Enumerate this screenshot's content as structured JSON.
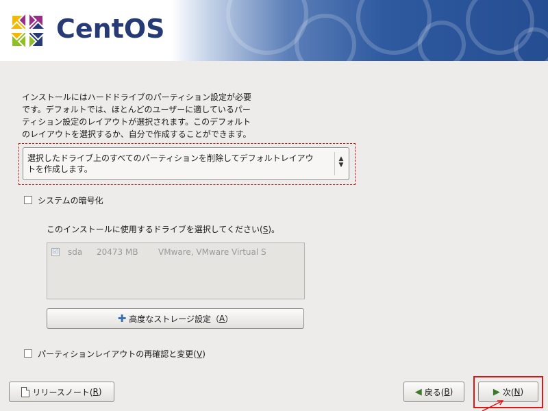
{
  "header": {
    "logo_text": "CentOS",
    "logo_icon": "centos-logo-icon",
    "colors": {
      "banner": "#2f5aa0",
      "logo_text": "#263a75"
    }
  },
  "intro": {
    "lines": [
      "インストールにはハードドライブのパーティション設定が必要",
      "です。デフォルトでは、ほとんどのユーザーに適しているパー",
      "ティション設定のレイアウトが選択されます。このデフォルト",
      "のレイアウトを選択するか、自分で作成することができます。"
    ]
  },
  "layout_combo": {
    "lines": [
      "選択したドライブ上のすべてのパーティションを削除してデフォルトレイアウ",
      "トを作成します。"
    ],
    "arrow_up": "▲",
    "arrow_down": "▼"
  },
  "encrypt": {
    "label": "システムの暗号化",
    "checked": false
  },
  "drives": {
    "label_pre": "このインストールに使用するドライブを選択してください(",
    "label_key": "S",
    "label_post": ")。",
    "items": [
      {
        "checked": true,
        "check_mark": "☑",
        "name": "sda",
        "size": "20473 MB",
        "model": "VMware, VMware Virtual S"
      }
    ]
  },
  "advanced_button": {
    "label_pre": "高度なストレージ設定（",
    "key": "A",
    "label_post": "）",
    "icon": "plus-icon"
  },
  "review": {
    "label_pre": "パーティションレイアウトの再確認と変更(",
    "key": "V",
    "label_post": ")",
    "checked": false
  },
  "footer": {
    "release_notes": {
      "label_pre": "リリースノート(",
      "key": "R",
      "label_post": ")",
      "icon": "document-icon"
    },
    "back": {
      "label_pre": "戻る(",
      "key": "B",
      "label_post": ")",
      "icon": "arrow-left-icon"
    },
    "next": {
      "label_pre": "次(",
      "key": "N",
      "label_post": ")",
      "icon": "arrow-right-icon"
    }
  },
  "colors": {
    "highlight": "#e01515",
    "background": "#edeceb"
  }
}
